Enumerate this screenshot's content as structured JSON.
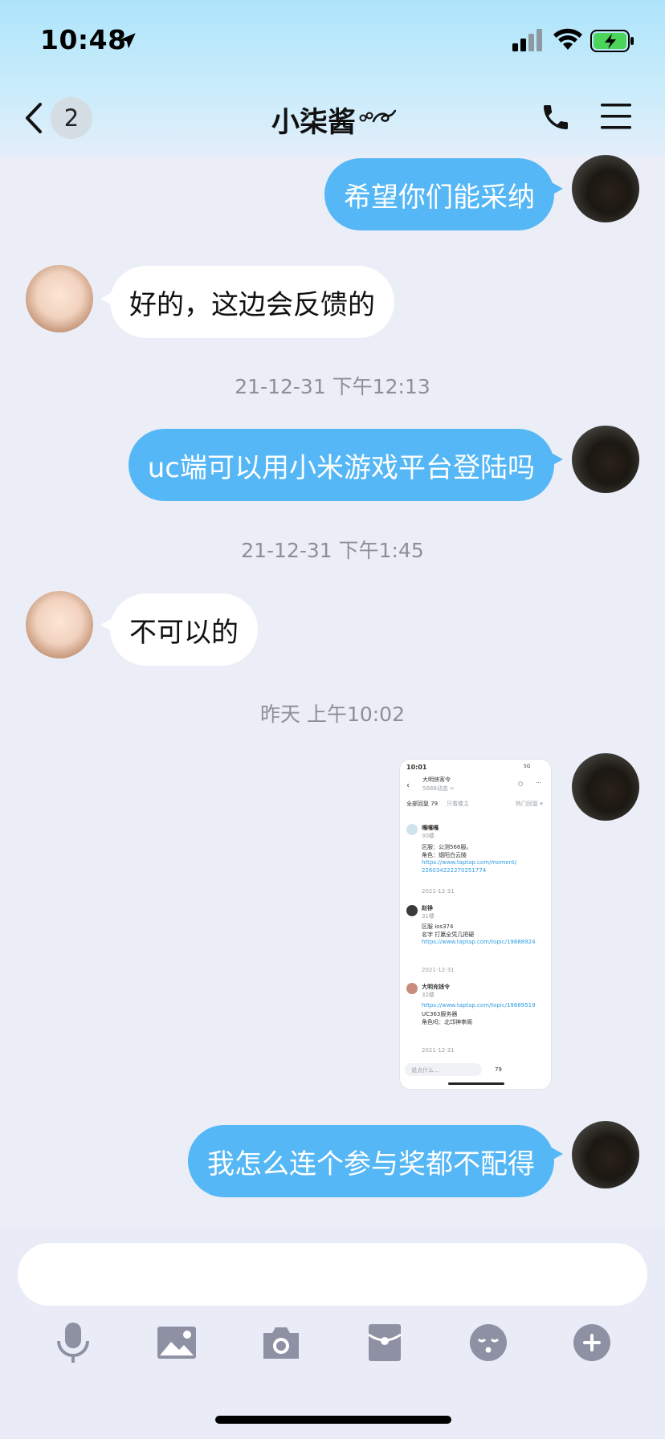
{
  "status_bar": {
    "time": "10:48"
  },
  "header": {
    "unread_count": "2",
    "title": "小柒酱"
  },
  "messages": [
    {
      "side": "out",
      "text": "希望你们能采纳"
    },
    {
      "side": "in",
      "text": "好的，这边会反馈的"
    },
    {
      "side": "out",
      "text": "uc端可以用小米游戏平台登陆吗"
    },
    {
      "side": "in",
      "text": "不可以的"
    },
    {
      "side": "out",
      "text": "我怎么连个参与奖都不配得"
    }
  ],
  "timestamps": [
    "21-12-31 下午12:13",
    "21-12-31 下午1:45",
    "昨天 上午10:02"
  ],
  "shared_screenshot": {
    "time": "10:01",
    "signal": "5G",
    "title": "大明侠客令",
    "subtitle": "5688动态 >",
    "tab_all": "全部回复 79",
    "tab_owner": "只看楼主",
    "sort": "热门回复 ▾",
    "posts": [
      {
        "name": "嘎嘎嘎",
        "floor": "30楼",
        "lines": [
          "区服：公测566服。",
          "角色：烟阳白云陵"
        ],
        "links": [
          "https://www.taptap.com/moment/",
          "226034222270251774"
        ],
        "date": "2021-12-31"
      },
      {
        "name": "赵铮",
        "floor": "31楼",
        "lines": [
          "区服 ios374",
          "名字 打赢全凭几把硬"
        ],
        "links": [
          "https://www.taptap.com/topic/19888924"
        ],
        "date": "2021-12-31"
      },
      {
        "name": "大明充钱令",
        "floor": "32楼",
        "lines": [
          "UC363服务器",
          "角色吗：北邙神拳阁"
        ],
        "links": [
          "https://www.taptap.com/topic/19889519"
        ],
        "date": "2021-12-31"
      }
    ],
    "input_placeholder": "说点什么...",
    "comment_count": "79"
  },
  "toolbar": {
    "icons": [
      "microphone-icon",
      "image-icon",
      "camera-icon",
      "red-packet-icon",
      "emoji-icon",
      "plus-icon"
    ]
  },
  "colors": {
    "outgoing_bubble": "#55b7f6",
    "incoming_bubble": "#ffffff",
    "background": "#eceef7",
    "toolbar_icon": "#8d91a3"
  }
}
